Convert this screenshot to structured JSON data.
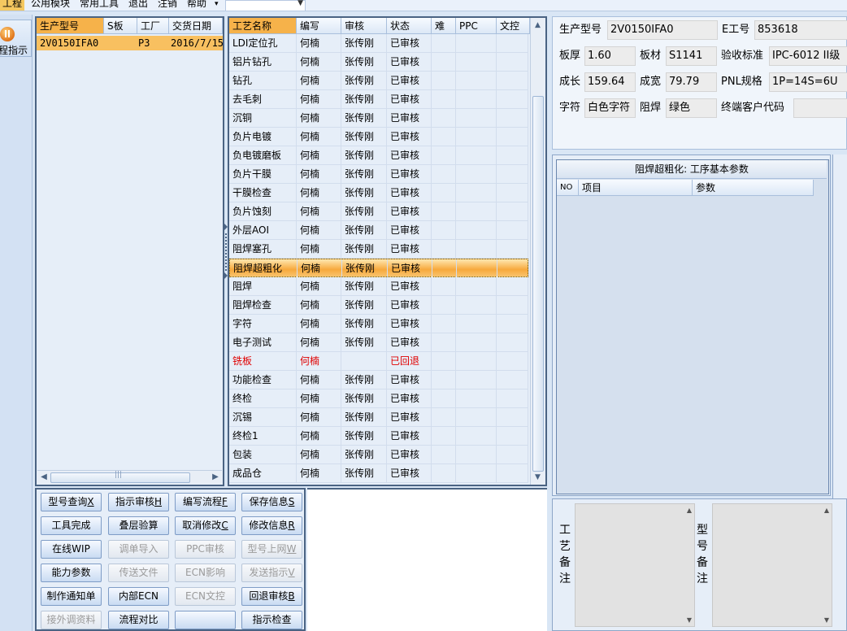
{
  "menu": [
    {
      "label": "工程",
      "active": true
    },
    {
      "label": "公用模块"
    },
    {
      "label": "常用工具"
    },
    {
      "label": "退出"
    },
    {
      "label": "注销"
    },
    {
      "label": "帮助"
    }
  ],
  "menu_dropdown_icon": "chevron-down-icon",
  "nav": {
    "icon": "process-indicator-icon",
    "label": "程指示"
  },
  "model_list": {
    "headers": [
      "生产型号",
      "S板",
      "工厂",
      "交货日期"
    ],
    "rows": [
      [
        "2V0150IFA0",
        "",
        "P3",
        "2016/7/15"
      ]
    ],
    "scroll_glyph": "|||"
  },
  "process": {
    "headers": [
      "工艺名称",
      "编写",
      "审核",
      "状态",
      "难",
      "PPC",
      "文控"
    ],
    "selected_index": 12,
    "rows": [
      {
        "name": "LDI定位孔",
        "writer": "何楠",
        "reviewer": "张传刚",
        "status": "已审核"
      },
      {
        "name": "铝片钻孔",
        "writer": "何楠",
        "reviewer": "张传刚",
        "status": "已审核"
      },
      {
        "name": "钻孔",
        "writer": "何楠",
        "reviewer": "张传刚",
        "status": "已审核"
      },
      {
        "name": "去毛刺",
        "writer": "何楠",
        "reviewer": "张传刚",
        "status": "已审核"
      },
      {
        "name": "沉铜",
        "writer": "何楠",
        "reviewer": "张传刚",
        "status": "已审核"
      },
      {
        "name": "负片电镀",
        "writer": "何楠",
        "reviewer": "张传刚",
        "status": "已审核"
      },
      {
        "name": "负电镀磨板",
        "writer": "何楠",
        "reviewer": "张传刚",
        "status": "已审核"
      },
      {
        "name": "负片干膜",
        "writer": "何楠",
        "reviewer": "张传刚",
        "status": "已审核"
      },
      {
        "name": "干膜检查",
        "writer": "何楠",
        "reviewer": "张传刚",
        "status": "已审核"
      },
      {
        "name": "负片蚀刻",
        "writer": "何楠",
        "reviewer": "张传刚",
        "status": "已审核"
      },
      {
        "name": "外层AOI",
        "writer": "何楠",
        "reviewer": "张传刚",
        "status": "已审核"
      },
      {
        "name": "阻焊塞孔",
        "writer": "何楠",
        "reviewer": "张传刚",
        "status": "已审核"
      },
      {
        "name": "阻焊超粗化",
        "writer": "何楠",
        "reviewer": "张传刚",
        "status": "已审核"
      },
      {
        "name": "阻焊",
        "writer": "何楠",
        "reviewer": "张传刚",
        "status": "已审核"
      },
      {
        "name": "阻焊检查",
        "writer": "何楠",
        "reviewer": "张传刚",
        "status": "已审核"
      },
      {
        "name": "字符",
        "writer": "何楠",
        "reviewer": "张传刚",
        "status": "已审核"
      },
      {
        "name": "电子测试",
        "writer": "何楠",
        "reviewer": "张传刚",
        "status": "已审核"
      },
      {
        "name": "铣板",
        "writer": "何楠",
        "reviewer": "",
        "status": "已回退",
        "returned": true
      },
      {
        "name": "功能检查",
        "writer": "何楠",
        "reviewer": "张传刚",
        "status": "已审核"
      },
      {
        "name": "终检",
        "writer": "何楠",
        "reviewer": "张传刚",
        "status": "已审核"
      },
      {
        "name": "沉锡",
        "writer": "何楠",
        "reviewer": "张传刚",
        "status": "已审核"
      },
      {
        "name": "终检1",
        "writer": "何楠",
        "reviewer": "张传刚",
        "status": "已审核"
      },
      {
        "name": "包装",
        "writer": "何楠",
        "reviewer": "张传刚",
        "status": "已审核"
      },
      {
        "name": "成品仓",
        "writer": "何楠",
        "reviewer": "张传刚",
        "status": "已审核"
      }
    ]
  },
  "info": {
    "model_label": "生产型号",
    "model": "2V0150IFA0",
    "eid_label": "E工号",
    "eid": "853618",
    "thickness_label": "板厚",
    "thickness": "1.60",
    "material_label": "板材",
    "material": "S1141",
    "standard_label": "验收标准",
    "standard": "IPC-6012 II级",
    "length_label": "成长",
    "length": "159.64",
    "width_label": "成宽",
    "width": "79.79",
    "pnl_label": "PNL规格",
    "pnl": "1P=14S=6U",
    "char_label": "字符",
    "char": "白色字符",
    "mask_label": "阻焊",
    "mask": "绿色",
    "customer_label": "终端客户代码",
    "customer": ""
  },
  "params": {
    "title": "阻焊超粗化: 工序基本参数",
    "headers": [
      "NO",
      "项目",
      "参数"
    ]
  },
  "remarks": {
    "process_label": [
      "工",
      "艺",
      "备",
      "注"
    ],
    "model_label": [
      "型",
      "号",
      "备",
      "注"
    ]
  },
  "buttons": [
    {
      "label": "型号查询",
      "key": "X",
      "enabled": true
    },
    {
      "label": "指示审核",
      "key": "H",
      "enabled": true
    },
    {
      "label": "编写流程",
      "key": "F",
      "enabled": true
    },
    {
      "label": "保存信息",
      "key": "S",
      "enabled": true
    },
    {
      "label": "工具完成",
      "key": "",
      "enabled": true
    },
    {
      "label": "叠层验算",
      "key": "",
      "enabled": true
    },
    {
      "label": "取消修改",
      "key": "C",
      "enabled": true
    },
    {
      "label": "修改信息",
      "key": "R",
      "enabled": true
    },
    {
      "label": "在线WIP",
      "key": "",
      "enabled": true
    },
    {
      "label": "调单导入",
      "key": "",
      "enabled": false
    },
    {
      "label": "PPC审核",
      "key": "",
      "enabled": false
    },
    {
      "label": "型号上网",
      "key": "W",
      "enabled": false
    },
    {
      "label": "能力参数",
      "key": "",
      "enabled": true
    },
    {
      "label": "传送文件",
      "key": "",
      "enabled": false
    },
    {
      "label": "ECN影响",
      "key": "",
      "enabled": false
    },
    {
      "label": "发送指示",
      "key": "V",
      "enabled": false
    },
    {
      "label": "制作通知单",
      "key": "",
      "enabled": true
    },
    {
      "label": "内部ECN",
      "key": "",
      "enabled": true
    },
    {
      "label": "ECN文控",
      "key": "",
      "enabled": false
    },
    {
      "label": "回退审核",
      "key": "B",
      "enabled": true
    },
    {
      "label": "接外调资料",
      "key": "",
      "enabled": false
    },
    {
      "label": "流程对比",
      "key": "",
      "enabled": true
    },
    {
      "label": "",
      "key": "",
      "enabled": true
    },
    {
      "label": "指示检查",
      "key": "",
      "enabled": true
    }
  ],
  "colors": {
    "selection": "#f8b84e",
    "returned": "#e00000",
    "frame": "#4a6383"
  }
}
